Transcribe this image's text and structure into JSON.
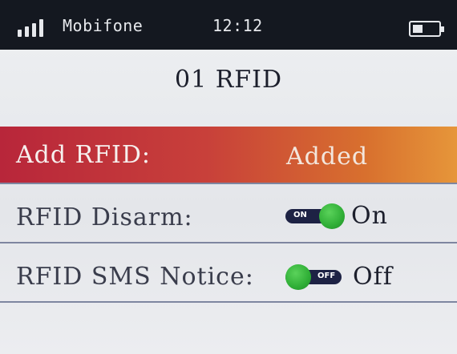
{
  "status_bar": {
    "carrier": "Mobifone",
    "time": "12:12",
    "icons": [
      "signal-icon",
      "battery-icon"
    ]
  },
  "page": {
    "title": "01 RFID"
  },
  "settings": [
    {
      "label": "Add RFID:",
      "value": "Added",
      "selected": true
    },
    {
      "label": "RFID Disarm:",
      "toggle_text": "ON",
      "state": "On",
      "enabled": true
    },
    {
      "label": "RFID SMS Notice:",
      "toggle_text": "OFF",
      "state": "Off",
      "enabled": false
    }
  ],
  "colors": {
    "status_bar_bg": "#141820",
    "selected_row_start": "#b8263a",
    "selected_row_end": "#e6963a",
    "toggle_knob": "#2fae36",
    "toggle_track": "#1d2244"
  }
}
